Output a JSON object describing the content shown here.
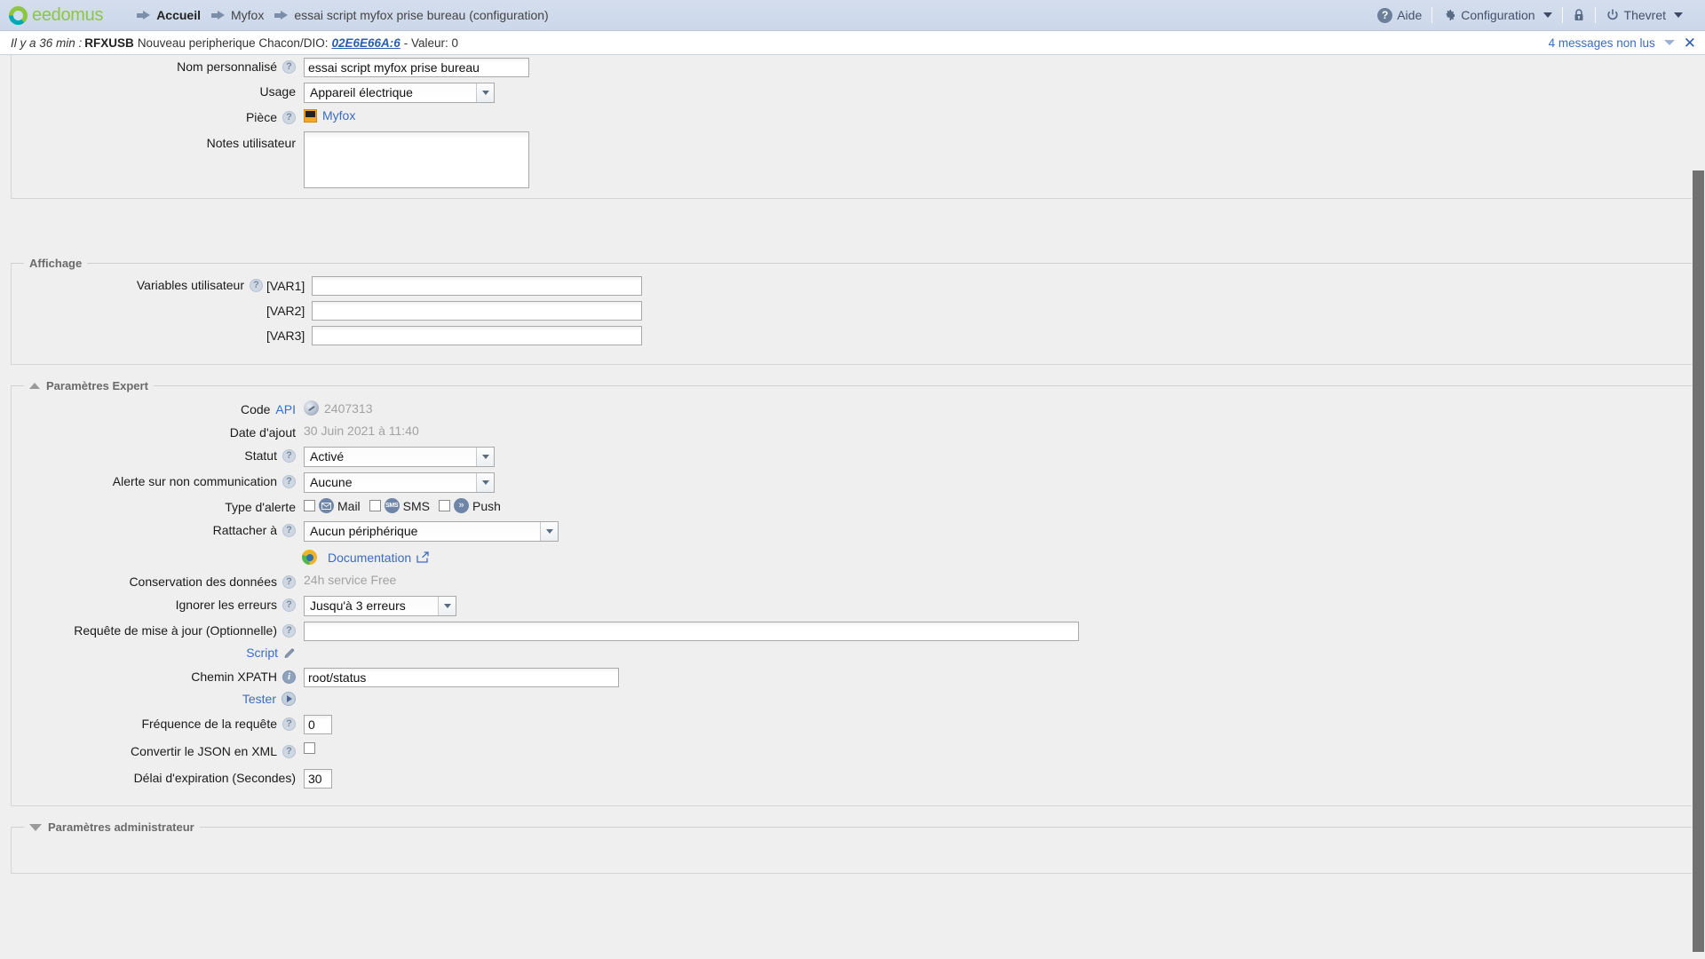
{
  "header": {
    "brand": "eedomus",
    "breadcrumbs": [
      {
        "label": "Accueil",
        "bold": true
      },
      {
        "label": "Myfox",
        "bold": false
      },
      {
        "label": "essai script myfox prise bureau (configuration)",
        "bold": false
      }
    ],
    "right_items": [
      {
        "label": "Aide",
        "icon": "help-icon"
      },
      {
        "label": "Configuration",
        "icon": "gear-icon",
        "caret": true
      },
      {
        "label": "",
        "icon": "lock-icon"
      },
      {
        "label": "Thevret",
        "icon": "power-icon",
        "caret": true
      }
    ]
  },
  "notification": {
    "time_prefix": "Il y a 36 min :",
    "source": "RFXUSB",
    "message": "Nouveau peripherique Chacon/DIO:",
    "device_id": "02E6E66A:6",
    "suffix": "- Valeur: 0",
    "unread_label": "4 messages non lus",
    "close_label": "✕"
  },
  "general": {
    "rows": {
      "nom_label": "Nom personnalisé",
      "nom_value": "essai script myfox prise bureau",
      "usage_label": "Usage",
      "usage_value": "Appareil électrique",
      "piece_label": "Pièce",
      "piece_value": "Myfox",
      "notes_label": "Notes utilisateur",
      "notes_value": ""
    }
  },
  "affichage": {
    "legend": "Affichage",
    "vars_label": "Variables utilisateur",
    "vars": [
      {
        "tag": "[VAR1]",
        "value": ""
      },
      {
        "tag": "[VAR2]",
        "value": ""
      },
      {
        "tag": "[VAR3]",
        "value": ""
      }
    ]
  },
  "expert": {
    "legend": "Paramètres Expert",
    "code_api_label_1": "Code",
    "code_api_label_2": "API",
    "code_api_value": "2407313",
    "date_label": "Date d'ajout",
    "date_value": "30 Juin 2021 à 11:40",
    "statut_label": "Statut",
    "statut_value": "Activé",
    "alerte_noncom_label": "Alerte sur non communication",
    "alerte_noncom_value": "Aucune",
    "type_alerte_label": "Type d'alerte",
    "alert_types": [
      {
        "label": "Mail",
        "icon": "mail-icon",
        "checked": false
      },
      {
        "label": "SMS",
        "icon": "sms-icon",
        "checked": false
      },
      {
        "label": "Push",
        "icon": "push-icon",
        "checked": false
      }
    ],
    "rattacher_label": "Rattacher à",
    "rattacher_value": "Aucun périphérique",
    "documentation_label": "Documentation",
    "conservation_label": "Conservation des données",
    "conservation_value": "24h service Free",
    "ignorer_label": "Ignorer les erreurs",
    "ignorer_value": "Jusqu'à 3 erreurs",
    "requete_label": "Requête de mise à jour (Optionnelle)",
    "requete_value": "",
    "script_label": "Script",
    "xpath_label": "Chemin XPATH",
    "xpath_value": "root/status",
    "tester_label": "Tester",
    "frequence_label": "Fréquence de la requête",
    "frequence_value": "0",
    "json_xml_label": "Convertir le JSON en XML",
    "json_xml_checked": false,
    "delai_label": "Délai d'expiration (Secondes)",
    "delai_value": "30"
  },
  "admin": {
    "legend": "Paramètres administrateur"
  },
  "colors": {
    "brand_green": "#8dc63f",
    "brand_teal": "#00a8b5",
    "link_blue": "#3b6cbf",
    "header_bg": "#d3dded",
    "content_bg": "#efefef"
  }
}
